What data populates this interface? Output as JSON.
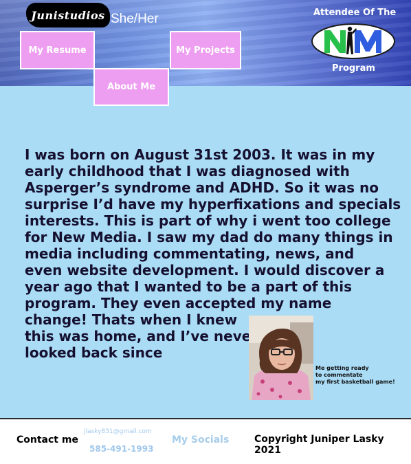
{
  "header": {
    "logo_text": "Junistudios",
    "pronouns": "She/Her",
    "nav": {
      "resume": "My Resume",
      "projects": "My Projects",
      "about": "About Me"
    },
    "badge": {
      "top_text": "Attendee Of The",
      "logo_letters": "NM",
      "bottom_text": "Program"
    }
  },
  "main": {
    "bio_lines": [
      "I was born on August 31st 2003. It was in my",
      "early childhood that I was diagnosed with",
      "Asperger’s syndrome and ADHD. So it was no",
      "surprise I’d have my hyperfixations and specials",
      "interests. This is part of why i went too college",
      "for New Media. I saw my dad do many things in",
      "media including commentating, news, and",
      "even website development. I would discover a",
      "year ago that I wanted to be a part of this",
      "program. They even accepted my name",
      "change! Thats when I knew",
      "this was home, and I’ve never",
      "looked back since"
    ],
    "caption_lines": [
      "Me getting ready",
      "to commentate",
      "my first basketball game!"
    ]
  },
  "footer": {
    "contact_label": "Contact me",
    "email": "jlasky831@gmail.com",
    "phone": "585-491-1993",
    "socials": "My Socials",
    "copyright": "Copyright Juniper Lasky 2021"
  },
  "colors": {
    "page_background": "#aadcf6",
    "nav_button": "#ee9ef0",
    "bio_text": "#161030",
    "footer_link": "#9fc7ec"
  }
}
